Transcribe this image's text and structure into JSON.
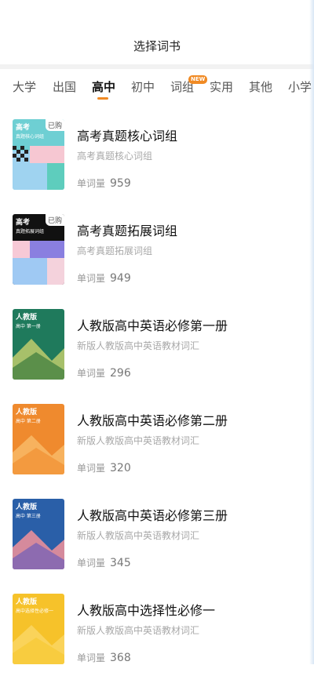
{
  "header": {
    "title": "选择词书"
  },
  "tabs": [
    {
      "label": "大学"
    },
    {
      "label": "出国"
    },
    {
      "label": "高中"
    },
    {
      "label": "初中"
    },
    {
      "label": "词组"
    },
    {
      "label": "实用"
    },
    {
      "label": "其他"
    },
    {
      "label": "小学"
    }
  ],
  "active_tab": "高中",
  "new_badge": "NEW",
  "count_label": "单词量",
  "books": [
    {
      "title": "高考真题核心词组",
      "subtitle": "高考真题核心词组",
      "count": "959",
      "cover_title": "高考",
      "cover_sub": "真题核心词组",
      "bought": "已购",
      "accent": "#6ecfd3"
    },
    {
      "title": "高考真题拓展词组",
      "subtitle": "高考真题拓展词组",
      "count": "949",
      "cover_title": "高考",
      "cover_sub": "真题拓展词组",
      "bought": "已购",
      "accent": "#111111"
    },
    {
      "title": "人教版高中英语必修第一册",
      "subtitle": "新版人教版高中英语教材词汇",
      "count": "296",
      "cover_title": "人教版",
      "cover_sub": "高中 第一册",
      "accent": "#1f7a5c"
    },
    {
      "title": "人教版高中英语必修第二册",
      "subtitle": "新版人教版高中英语教材词汇",
      "count": "320",
      "cover_title": "人教版",
      "cover_sub": "高中 第二册",
      "accent": "#ef8a2e"
    },
    {
      "title": "人教版高中英语必修第三册",
      "subtitle": "新版人教版高中英语教材词汇",
      "count": "345",
      "cover_title": "人教版",
      "cover_sub": "高中 第三册",
      "accent": "#2a5fa8"
    },
    {
      "title": "人教版高中选择性必修一",
      "subtitle": "新版人教版高中英语教材词汇",
      "count": "368",
      "cover_title": "人教版",
      "cover_sub": "高中选择性必修一",
      "accent": "#f6c22a"
    }
  ]
}
